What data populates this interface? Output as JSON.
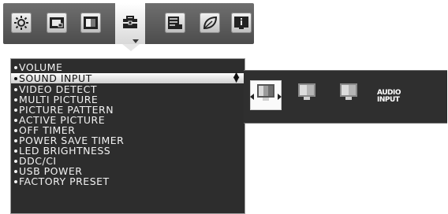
{
  "top_tabs": [
    {
      "icon": "brightness-sun-icon"
    },
    {
      "icon": "screen-size-icon"
    },
    {
      "icon": "color-icon"
    },
    {
      "icon": "tools-toolbox-icon",
      "active": true
    },
    {
      "icon": "menu-tools-icon"
    },
    {
      "icon": "eco-leaf-icon"
    },
    {
      "icon": "information-icon"
    }
  ],
  "menu": {
    "items": [
      {
        "label": "VOLUME"
      },
      {
        "label": "SOUND INPUT",
        "selected": true
      },
      {
        "label": "VIDEO DETECT"
      },
      {
        "label": "MULTI PICTURE"
      },
      {
        "label": "PICTURE PATTERN"
      },
      {
        "label": "ACTIVE PICTURE"
      },
      {
        "label": "OFF TIMER"
      },
      {
        "label": "POWER SAVE TIMER"
      },
      {
        "label": "LED BRIGHTNESS"
      },
      {
        "label": "DDC/CI"
      },
      {
        "label": "USB POWER"
      },
      {
        "label": "FACTORY PRESET"
      }
    ]
  },
  "sound_input_options": {
    "audio_label_line1": "AUDIO",
    "audio_label_line2": "INPUT",
    "options": [
      {
        "icon": "monitor-picture-icon",
        "selected": true
      },
      {
        "icon": "monitor-picture-icon"
      },
      {
        "icon": "monitor-picture-icon"
      }
    ]
  },
  "colors": {
    "menu_bg": "#2d2d2d",
    "highlight": "#ffffff",
    "topbar": "#5a5a5a"
  }
}
